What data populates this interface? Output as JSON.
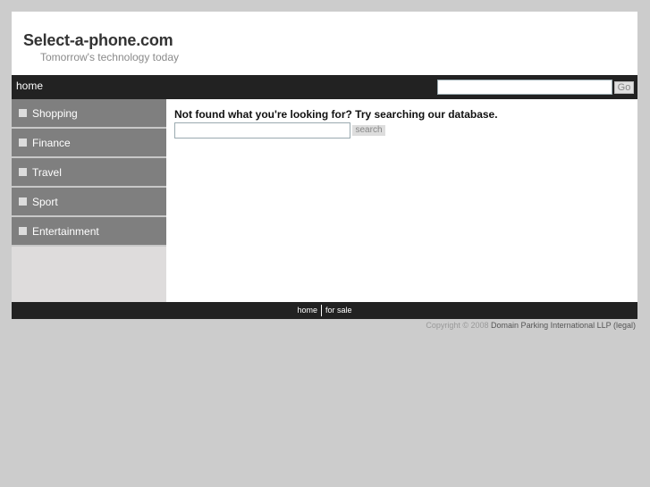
{
  "header": {
    "site_title": "Select-a-phone.com",
    "tagline": "Tomorrow's technology today"
  },
  "navbar": {
    "home_label": "home",
    "search_value": "",
    "go_label": "Go"
  },
  "sidebar": {
    "items": [
      {
        "label": "Shopping"
      },
      {
        "label": "Finance"
      },
      {
        "label": "Travel"
      },
      {
        "label": "Sport"
      },
      {
        "label": "Entertainment"
      }
    ]
  },
  "content": {
    "heading": "Not found what you're looking for? Try searching our database.",
    "search_value": "",
    "search_button_label": "search"
  },
  "footer": {
    "links": [
      {
        "label": "home"
      },
      {
        "label": "for sale"
      }
    ],
    "copyright_prefix": "Copyright © 2008",
    "company": "Domain Parking International LLP",
    "legal_label": "(legal)"
  }
}
